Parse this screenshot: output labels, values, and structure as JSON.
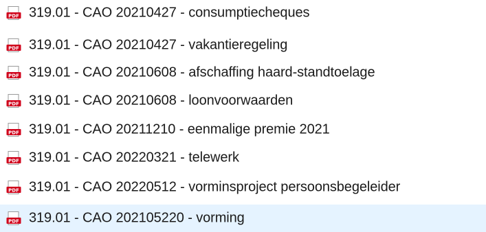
{
  "files": {
    "icon": "pdf-file-icon",
    "icon_badge": "PDF",
    "accent_color": "#d0021b",
    "selected_background": "#e5f3ff",
    "items": [
      {
        "name": "319.01 - CAO 20210427 - consumptiecheques",
        "selected": false
      },
      {
        "name": "319.01 - CAO 20210427 - vakantieregeling",
        "selected": false
      },
      {
        "name": "319.01 - CAO 20210608 - afschaffing haard-standtoelage",
        "selected": false
      },
      {
        "name": "319.01 - CAO 20210608 - loonvoorwaarden",
        "selected": false
      },
      {
        "name": "319.01 - CAO 20211210 - eenmalige premie 2021",
        "selected": false
      },
      {
        "name": "319.01 - CAO 20220321 - telewerk",
        "selected": false
      },
      {
        "name": "319.01 - CAO 20220512 - vorminsproject persoonsbegeleider",
        "selected": false
      },
      {
        "name": "319.01 - CAO 202105220 - vorming",
        "selected": true
      }
    ]
  }
}
